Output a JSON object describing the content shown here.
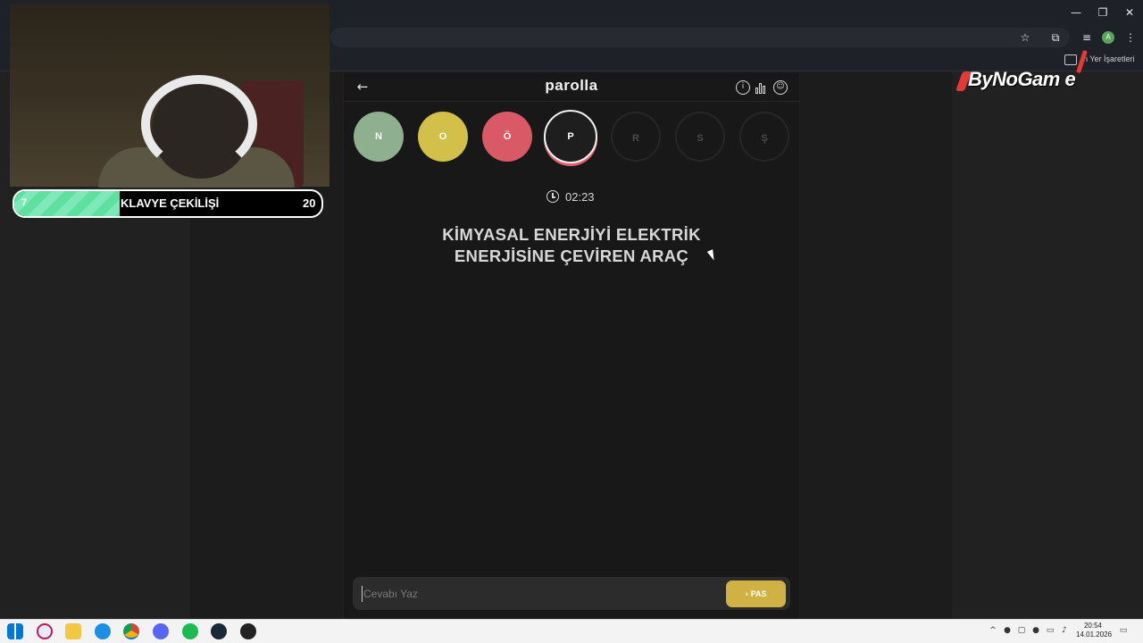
{
  "app": {
    "title": "parolla",
    "letters": [
      {
        "letter": "N",
        "state": "correct",
        "color": "#8fb08e"
      },
      {
        "letter": "O",
        "state": "pass",
        "color": "#d2c04b"
      },
      {
        "letter": "Ö",
        "state": "wrong",
        "color": "#d95a66"
      },
      {
        "letter": "P",
        "state": "current",
        "color": "#1e1e1e"
      },
      {
        "letter": "R",
        "state": "pending"
      },
      {
        "letter": "S",
        "state": "pending"
      },
      {
        "letter": "Ş",
        "state": "pending"
      }
    ],
    "timer": "02:23",
    "question_line1": "KİMYASAL ENERJİYİ ELEKTRİK",
    "question_line2": "ENERJİSİNE ÇEVİREN ARAÇ",
    "answer_placeholder": "Cevabı Yaz",
    "pass_label": "PAS"
  },
  "browser": {
    "bookmarks_label": "n Yer İşaretleri",
    "profile_initial": "A"
  },
  "overlay": {
    "progress_current": "7",
    "progress_label": "KLAVYE ÇEKİLİŞİ",
    "progress_target": "20",
    "progress_fraction": 0.35,
    "logo_text": "ByNoGam e"
  },
  "taskbar": {
    "time": "20:54",
    "date": "14.01.2026"
  }
}
